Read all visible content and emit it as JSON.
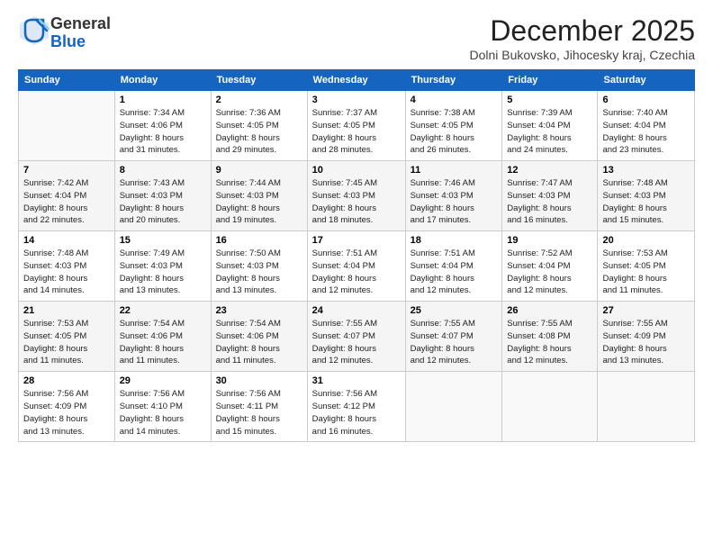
{
  "logo": {
    "line1": "General",
    "line2": "Blue"
  },
  "title": "December 2025",
  "subtitle": "Dolni Bukovsko, Jihocesky kraj, Czechia",
  "days_of_week": [
    "Sunday",
    "Monday",
    "Tuesday",
    "Wednesday",
    "Thursday",
    "Friday",
    "Saturday"
  ],
  "weeks": [
    [
      {
        "day": "",
        "info": ""
      },
      {
        "day": "1",
        "info": "Sunrise: 7:34 AM\nSunset: 4:06 PM\nDaylight: 8 hours\nand 31 minutes."
      },
      {
        "day": "2",
        "info": "Sunrise: 7:36 AM\nSunset: 4:05 PM\nDaylight: 8 hours\nand 29 minutes."
      },
      {
        "day": "3",
        "info": "Sunrise: 7:37 AM\nSunset: 4:05 PM\nDaylight: 8 hours\nand 28 minutes."
      },
      {
        "day": "4",
        "info": "Sunrise: 7:38 AM\nSunset: 4:05 PM\nDaylight: 8 hours\nand 26 minutes."
      },
      {
        "day": "5",
        "info": "Sunrise: 7:39 AM\nSunset: 4:04 PM\nDaylight: 8 hours\nand 24 minutes."
      },
      {
        "day": "6",
        "info": "Sunrise: 7:40 AM\nSunset: 4:04 PM\nDaylight: 8 hours\nand 23 minutes."
      }
    ],
    [
      {
        "day": "7",
        "info": "Sunrise: 7:42 AM\nSunset: 4:04 PM\nDaylight: 8 hours\nand 22 minutes."
      },
      {
        "day": "8",
        "info": "Sunrise: 7:43 AM\nSunset: 4:03 PM\nDaylight: 8 hours\nand 20 minutes."
      },
      {
        "day": "9",
        "info": "Sunrise: 7:44 AM\nSunset: 4:03 PM\nDaylight: 8 hours\nand 19 minutes."
      },
      {
        "day": "10",
        "info": "Sunrise: 7:45 AM\nSunset: 4:03 PM\nDaylight: 8 hours\nand 18 minutes."
      },
      {
        "day": "11",
        "info": "Sunrise: 7:46 AM\nSunset: 4:03 PM\nDaylight: 8 hours\nand 17 minutes."
      },
      {
        "day": "12",
        "info": "Sunrise: 7:47 AM\nSunset: 4:03 PM\nDaylight: 8 hours\nand 16 minutes."
      },
      {
        "day": "13",
        "info": "Sunrise: 7:48 AM\nSunset: 4:03 PM\nDaylight: 8 hours\nand 15 minutes."
      }
    ],
    [
      {
        "day": "14",
        "info": "Sunrise: 7:48 AM\nSunset: 4:03 PM\nDaylight: 8 hours\nand 14 minutes."
      },
      {
        "day": "15",
        "info": "Sunrise: 7:49 AM\nSunset: 4:03 PM\nDaylight: 8 hours\nand 13 minutes."
      },
      {
        "day": "16",
        "info": "Sunrise: 7:50 AM\nSunset: 4:03 PM\nDaylight: 8 hours\nand 13 minutes."
      },
      {
        "day": "17",
        "info": "Sunrise: 7:51 AM\nSunset: 4:04 PM\nDaylight: 8 hours\nand 12 minutes."
      },
      {
        "day": "18",
        "info": "Sunrise: 7:51 AM\nSunset: 4:04 PM\nDaylight: 8 hours\nand 12 minutes."
      },
      {
        "day": "19",
        "info": "Sunrise: 7:52 AM\nSunset: 4:04 PM\nDaylight: 8 hours\nand 12 minutes."
      },
      {
        "day": "20",
        "info": "Sunrise: 7:53 AM\nSunset: 4:05 PM\nDaylight: 8 hours\nand 11 minutes."
      }
    ],
    [
      {
        "day": "21",
        "info": "Sunrise: 7:53 AM\nSunset: 4:05 PM\nDaylight: 8 hours\nand 11 minutes."
      },
      {
        "day": "22",
        "info": "Sunrise: 7:54 AM\nSunset: 4:06 PM\nDaylight: 8 hours\nand 11 minutes."
      },
      {
        "day": "23",
        "info": "Sunrise: 7:54 AM\nSunset: 4:06 PM\nDaylight: 8 hours\nand 11 minutes."
      },
      {
        "day": "24",
        "info": "Sunrise: 7:55 AM\nSunset: 4:07 PM\nDaylight: 8 hours\nand 12 minutes."
      },
      {
        "day": "25",
        "info": "Sunrise: 7:55 AM\nSunset: 4:07 PM\nDaylight: 8 hours\nand 12 minutes."
      },
      {
        "day": "26",
        "info": "Sunrise: 7:55 AM\nSunset: 4:08 PM\nDaylight: 8 hours\nand 12 minutes."
      },
      {
        "day": "27",
        "info": "Sunrise: 7:55 AM\nSunset: 4:09 PM\nDaylight: 8 hours\nand 13 minutes."
      }
    ],
    [
      {
        "day": "28",
        "info": "Sunrise: 7:56 AM\nSunset: 4:09 PM\nDaylight: 8 hours\nand 13 minutes."
      },
      {
        "day": "29",
        "info": "Sunrise: 7:56 AM\nSunset: 4:10 PM\nDaylight: 8 hours\nand 14 minutes."
      },
      {
        "day": "30",
        "info": "Sunrise: 7:56 AM\nSunset: 4:11 PM\nDaylight: 8 hours\nand 15 minutes."
      },
      {
        "day": "31",
        "info": "Sunrise: 7:56 AM\nSunset: 4:12 PM\nDaylight: 8 hours\nand 16 minutes."
      },
      {
        "day": "",
        "info": ""
      },
      {
        "day": "",
        "info": ""
      },
      {
        "day": "",
        "info": ""
      }
    ]
  ]
}
